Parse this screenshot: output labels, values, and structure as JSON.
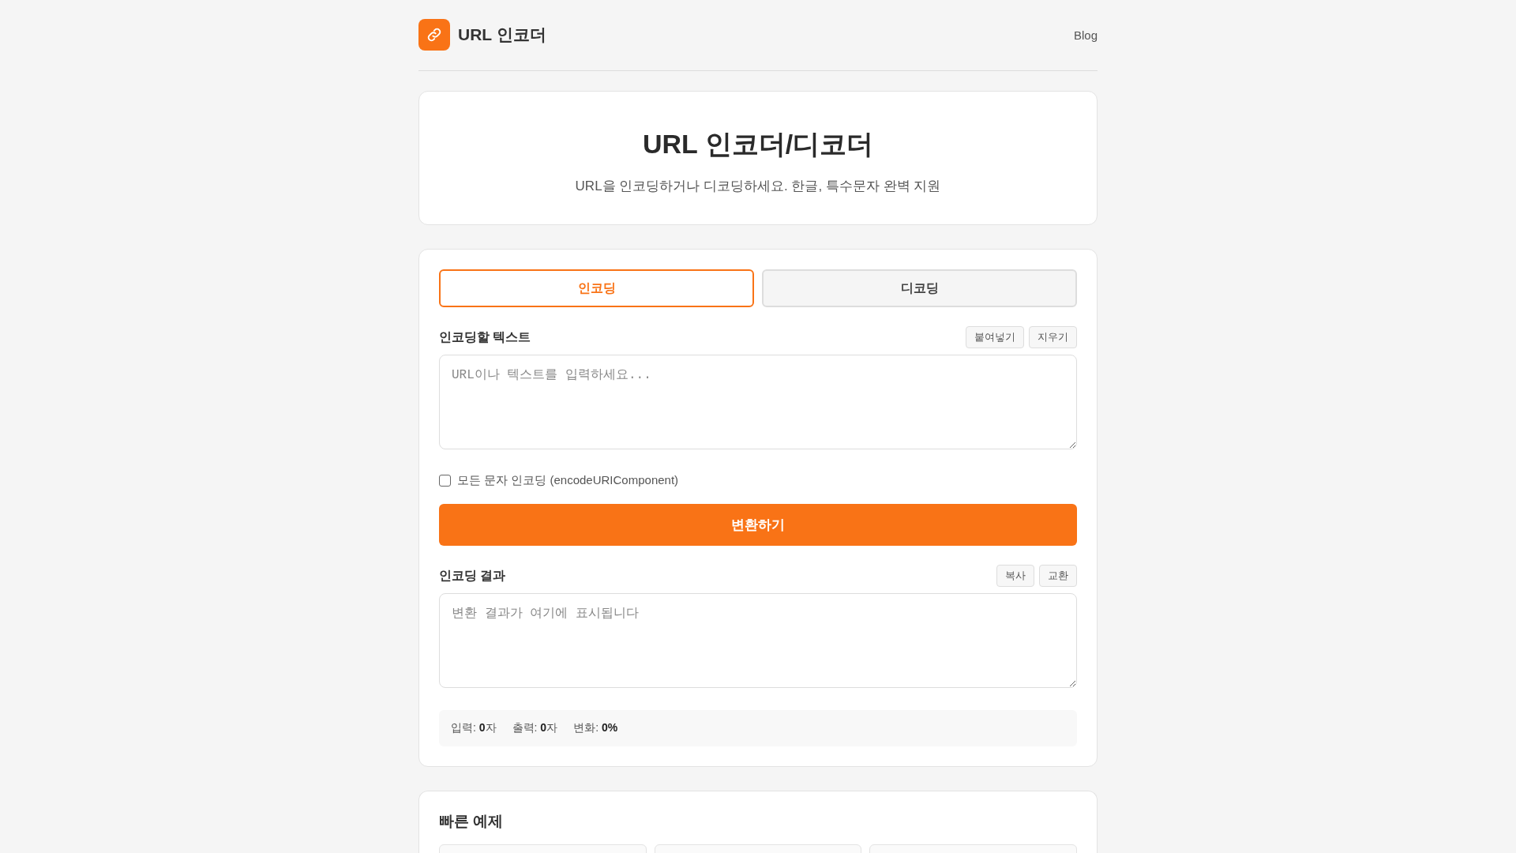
{
  "header": {
    "title": "URL 인코더",
    "nav_link": "Blog"
  },
  "hero": {
    "title": "URL 인코더/디코더",
    "subtitle": "URL을 인코딩하거나 디코딩하세요. 한글, 특수문자 완벽 지원"
  },
  "tabs": [
    {
      "label": "인코딩",
      "selected": true
    },
    {
      "label": "디코딩",
      "selected": false
    }
  ],
  "input": {
    "label": "인코딩할 텍스트",
    "actions": [
      "붙여넣기",
      "지우기"
    ],
    "placeholder": "URL이나 텍스트를 입력하세요..."
  },
  "option": {
    "label": "모든 문자 인코딩 (encodeURIComponent)",
    "checked": false
  },
  "convert_button": "변환하기",
  "output": {
    "label": "인코딩 결과",
    "actions": [
      "복사",
      "교환"
    ],
    "placeholder": "변환 결과가 여기에 표시됩니다"
  },
  "stats": [
    "입력: **0**자",
    "출력: **0**자",
    "변화: **0%**"
  ],
  "examples": {
    "title": "빠른 예제"
  }
}
